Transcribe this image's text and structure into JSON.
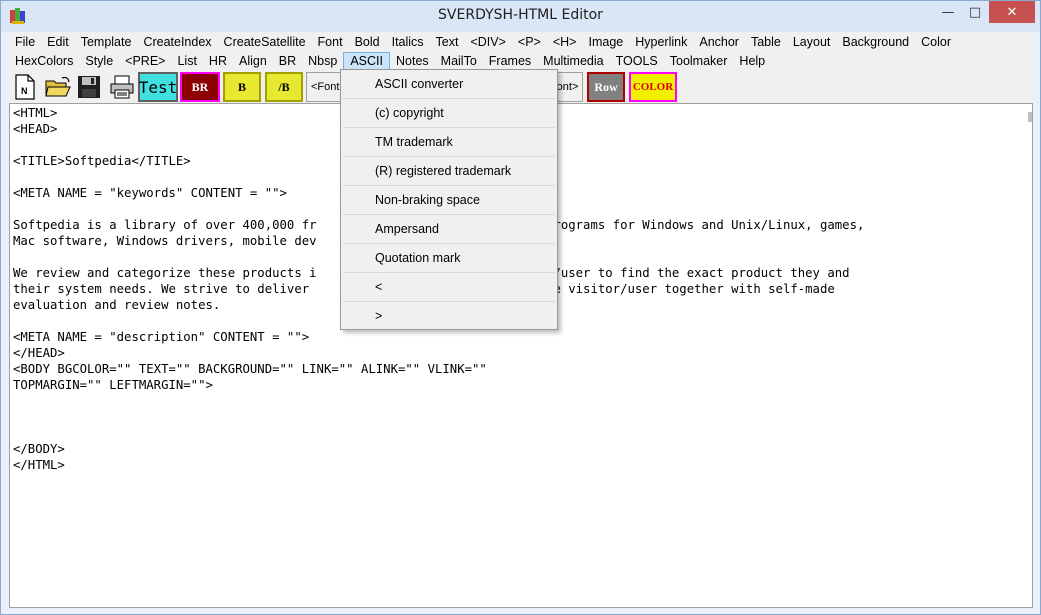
{
  "window": {
    "title": "SVERDYSH-HTML Editor",
    "minimize_glyph": "—",
    "maximize_glyph": "□",
    "close_glyph": "✕"
  },
  "menu_row1": [
    "File",
    "Edit",
    "Template",
    "CreateIndex",
    "CreateSatellite",
    "Font",
    "Bold",
    "Italics",
    "Text",
    "<DIV>",
    "<P>",
    "<H>",
    "Image",
    "Hyperlink",
    "Anchor",
    "Table",
    "Layout",
    "Background",
    "Color"
  ],
  "menu_row2": [
    "HexColors",
    "Style",
    "<PRE>",
    "List",
    "HR",
    "Align",
    "BR",
    "Nbsp",
    "ASCII",
    "Notes",
    "MailTo",
    "Frames",
    "Multimedia",
    "TOOLS",
    "Toolmaker",
    "Help"
  ],
  "active_menu": "ASCII",
  "toolbar": {
    "test_label": "Test",
    "br_label": "BR",
    "b_label": "B",
    "endb_label": "/B",
    "font_label": "<Font",
    "endfont_label": "font>",
    "row_label": "Row",
    "color_label": "COLOR",
    "new_icon_letter": "N"
  },
  "ascii_menu": {
    "items": [
      "ASCII converter",
      "(c) copyright",
      "TM trademark",
      "(R) registered trademark",
      "Non-braking space",
      "Ampersand",
      "Quotation mark",
      "<",
      ">"
    ]
  },
  "editor": {
    "content": "<HTML>\n<HEAD>\n\n<TITLE>Softpedia</TITLE>\n\n<META NAME = \"keywords\" CONTENT = \"\">\n\nSoftpedia is a library of over 400,000 fr                               programs for Windows and Unix/Linux, games,\nMac software, Windows drivers, mobile dev                               s.\n\nWe review and categorize these products i                               r/user to find the exact product they and\ntheir system needs. We strive to deliver                                he visitor/user together with self-made\nevaluation and review notes.\n\n<META NAME = \"description\" CONTENT = \"\">\n</HEAD>\n<BODY BGCOLOR=\"\" TEXT=\"\" BACKGROUND=\"\" LINK=\"\" ALINK=\"\" VLINK=\"\"\nTOPMARGIN=\"\" LEFTMARGIN=\"\">\n\n\n\n</BODY>\n</HTML>"
  }
}
